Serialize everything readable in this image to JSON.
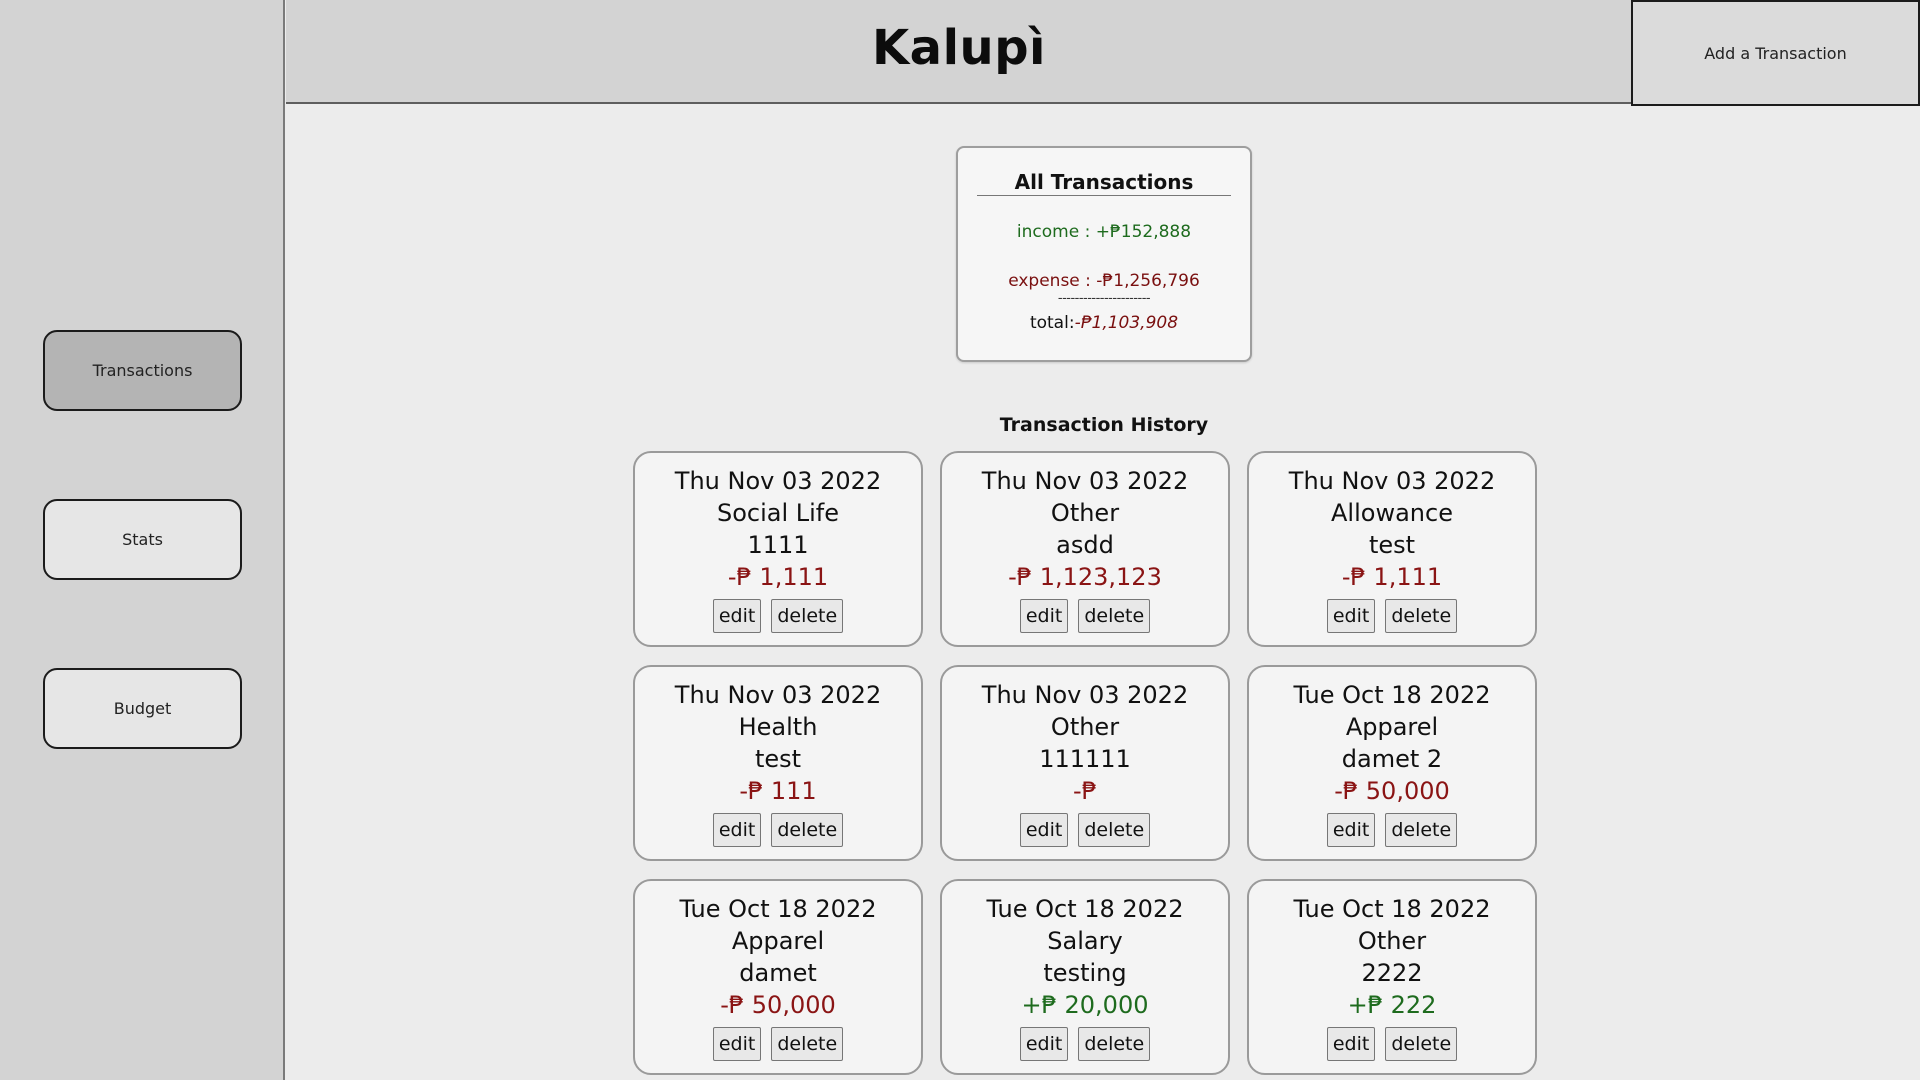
{
  "sidebar": {
    "items": [
      {
        "label": "Transactions",
        "active": true
      },
      {
        "label": "Stats",
        "active": false
      },
      {
        "label": "Budget",
        "active": false
      }
    ]
  },
  "header": {
    "title": "Kalupì",
    "add_button": "Add a Transaction"
  },
  "summary": {
    "title": "All Transactions",
    "income": "income : +₱152,888",
    "expense": "expense : -₱1,256,796",
    "divider": "----------------------",
    "total_label": "total:",
    "total_value": "-₱1,103,908"
  },
  "history": {
    "title": "Transaction History",
    "edit_label": "edit",
    "delete_label": "delete",
    "cards": [
      {
        "date": "Thu Nov 03 2022",
        "category": "Social Life",
        "note": "1111",
        "amount": "-₱ 1,111",
        "type": "neg"
      },
      {
        "date": "Thu Nov 03 2022",
        "category": "Other",
        "note": "asdd",
        "amount": "-₱ 1,123,123",
        "type": "neg"
      },
      {
        "date": "Thu Nov 03 2022",
        "category": "Allowance",
        "note": "test",
        "amount": "-₱ 1,111",
        "type": "neg"
      },
      {
        "date": "Thu Nov 03 2022",
        "category": "Health",
        "note": "test",
        "amount": "-₱ 111",
        "type": "neg"
      },
      {
        "date": "Thu Nov 03 2022",
        "category": "Other",
        "note": "111111",
        "amount": "-₱",
        "type": "neg"
      },
      {
        "date": "Tue Oct 18 2022",
        "category": "Apparel",
        "note": "damet 2",
        "amount": "-₱ 50,000",
        "type": "neg"
      },
      {
        "date": "Tue Oct 18 2022",
        "category": "Apparel",
        "note": "damet",
        "amount": "-₱ 50,000",
        "type": "neg"
      },
      {
        "date": "Tue Oct 18 2022",
        "category": "Salary",
        "note": "testing",
        "amount": "+₱ 20,000",
        "type": "pos"
      },
      {
        "date": "Tue Oct 18 2022",
        "category": "Other",
        "note": "2222",
        "amount": "+₱ 222",
        "type": "pos"
      }
    ]
  },
  "colors": {
    "income": "#1e6b1e",
    "expense": "#8a1414",
    "sidebar_bg": "#d3d3d3",
    "page_bg": "#ececec"
  }
}
